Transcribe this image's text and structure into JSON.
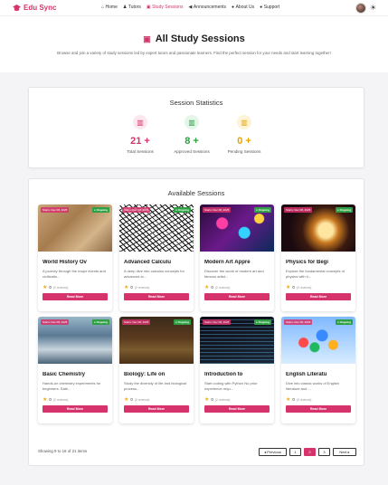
{
  "nav": {
    "logo": "Edu Sync",
    "links": [
      {
        "label": "Home",
        "icon": "home-icon"
      },
      {
        "label": "Tutors",
        "icon": "tutors-icon"
      },
      {
        "label": "Study Sessions",
        "icon": "book-icon"
      },
      {
        "label": "Announcements",
        "icon": "megaphone-icon"
      },
      {
        "label": "About Us",
        "icon": "info-icon"
      },
      {
        "label": "Support",
        "icon": "help-icon"
      }
    ],
    "theme_icon": "☀"
  },
  "hero": {
    "title": "All Study Sessions",
    "subtitle": "Browse and join a variety of study sessions led by expert tutors and passionate learners. Find the perfect session for your needs and start learning together!"
  },
  "stats": {
    "title": "Session Statistics",
    "items": [
      {
        "value": "21 +",
        "label": "Total Sessions",
        "color": "#d6336c",
        "bg": "#fde7ef"
      },
      {
        "value": "8 +",
        "label": "Approved Sessions",
        "color": "#2ea043",
        "bg": "#e3f6e8"
      },
      {
        "value": "0 +",
        "label": "Pending Sessions",
        "color": "#e8a400",
        "bg": "#fdf3d6"
      }
    ]
  },
  "sessions": {
    "title": "Available Sessions",
    "cards": [
      {
        "title": "World History Ov",
        "desc": "A journey through the major events and civilizatio...",
        "date": "Starts: Dec 08, 2025",
        "status": "Ongoing",
        "rating": "0",
        "reviews": "(0 reviews)",
        "button": "Read More",
        "img": "img-history"
      },
      {
        "title": "Advanced Calculu",
        "desc": "A deep dive into calculus concepts for advanced st...",
        "date": "Starts: Dec 08, 2025",
        "status": "Ongoing",
        "rating": "0",
        "reviews": "(0 reviews)",
        "button": "Read More",
        "img": "img-calc"
      },
      {
        "title": "Modern Art Appre",
        "desc": "Discover the world of modern art and famous artist...",
        "date": "Starts: Dec 08, 2025",
        "status": "Ongoing",
        "rating": "0",
        "reviews": "(0 reviews)",
        "button": "Read More",
        "img": "img-art"
      },
      {
        "title": "Physics for Begi",
        "desc": "Explore the fundamental concepts of physics with h...",
        "date": "Starts: Dec 08, 2025",
        "status": "Ongoing",
        "rating": "0",
        "reviews": "(0 reviews)",
        "button": "Read More",
        "img": "img-physics"
      },
      {
        "title": "Basic Chemistry",
        "desc": "Hands-on chemistry experiments for beginners. Safe...",
        "date": "Starts: Dec 08, 2025",
        "status": "Ongoing",
        "rating": "0",
        "reviews": "(0 reviews)",
        "button": "Read More",
        "img": "img-chem"
      },
      {
        "title": "Biology: Life on",
        "desc": "Study the diversity of life and biological process...",
        "date": "Starts: Dec 08, 2025",
        "status": "Ongoing",
        "rating": "0",
        "reviews": "(0 reviews)",
        "button": "Read More",
        "img": "img-bio"
      },
      {
        "title": "Introduction to",
        "desc": "Start coding with Python No prior experience requ...",
        "date": "Starts: Dec 08, 2025",
        "status": "Ongoing",
        "rating": "0",
        "reviews": "(0 reviews)",
        "button": "Read More",
        "img": "img-prog"
      },
      {
        "title": "English Literatu",
        "desc": "Dive into classic works of English literature and ...",
        "date": "Starts: Dec 08, 2025",
        "status": "Ongoing",
        "rating": "0",
        "reviews": "(0 reviews)",
        "button": "Read More",
        "img": "img-eng"
      }
    ],
    "showing": "Showing 9 to 16 of 21 items",
    "pager": {
      "prev": "Previous",
      "pages": [
        "1",
        "2",
        "3"
      ],
      "active": "2",
      "next": "Next"
    }
  }
}
